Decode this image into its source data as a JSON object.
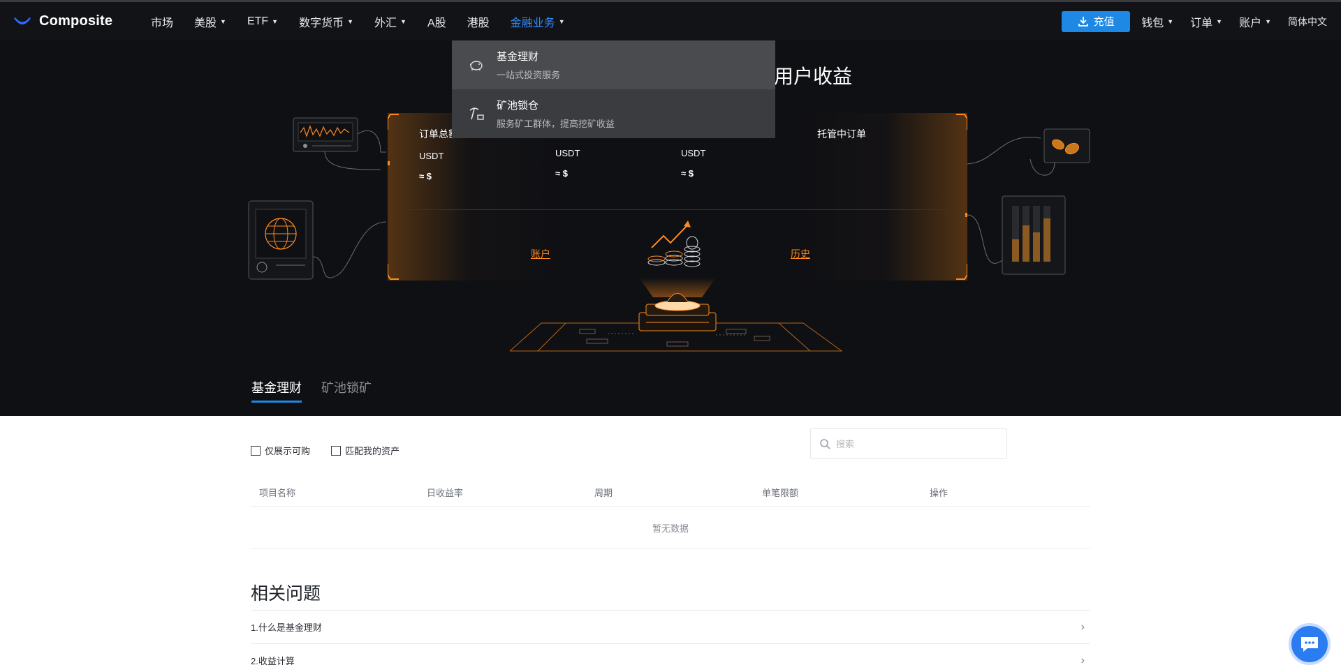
{
  "brand": {
    "name": "Composite",
    "accent": "#1e88e5",
    "highlight": "#ff8a1c"
  },
  "nav": {
    "left": [
      {
        "label": "市场",
        "dropdown": false
      },
      {
        "label": "美股",
        "dropdown": true
      },
      {
        "label": "ETF",
        "dropdown": true
      },
      {
        "label": "数字货币",
        "dropdown": true
      },
      {
        "label": "外汇",
        "dropdown": true
      },
      {
        "label": "A股",
        "dropdown": false
      },
      {
        "label": "港股",
        "dropdown": false
      },
      {
        "label": "金融业务",
        "dropdown": true,
        "active": true
      }
    ],
    "recharge_label": "充值",
    "right": [
      {
        "label": "钱包"
      },
      {
        "label": "订单"
      },
      {
        "label": "账户"
      }
    ],
    "language": "简体中文"
  },
  "dropdown": {
    "items": [
      {
        "title": "基金理财",
        "desc": "一站式投资服务",
        "icon": "piggy-bank-icon"
      },
      {
        "title": "矿池锁仓",
        "desc": "服务矿工群体，提高挖矿收益",
        "icon": "pickaxe-icon"
      }
    ]
  },
  "hero": {
    "title": "用户收益",
    "stats": [
      {
        "label": "订单总额",
        "unit": "USDT",
        "approx": "≈ $"
      },
      {
        "label": "",
        "unit": "USDT",
        "approx": "≈ $"
      },
      {
        "label": "",
        "unit": "USDT",
        "approx": "≈ $"
      },
      {
        "label": "托管中订单",
        "unit": "",
        "approx": ""
      }
    ],
    "links": {
      "account": "账户",
      "history": "历史"
    },
    "tabs": [
      "基金理财",
      "矿池锁矿"
    ]
  },
  "filters": {
    "only_purchasable": "仅展示可购",
    "match_assets": "匹配我的资产"
  },
  "search": {
    "placeholder": "搜索"
  },
  "table": {
    "columns": [
      "项目名称",
      "日收益率",
      "周期",
      "单笔限额",
      "操作"
    ],
    "empty_text": "暂无数据"
  },
  "faq": {
    "title": "相关问题",
    "items": [
      "1.什么是基金理财",
      "2.收益计算"
    ]
  }
}
